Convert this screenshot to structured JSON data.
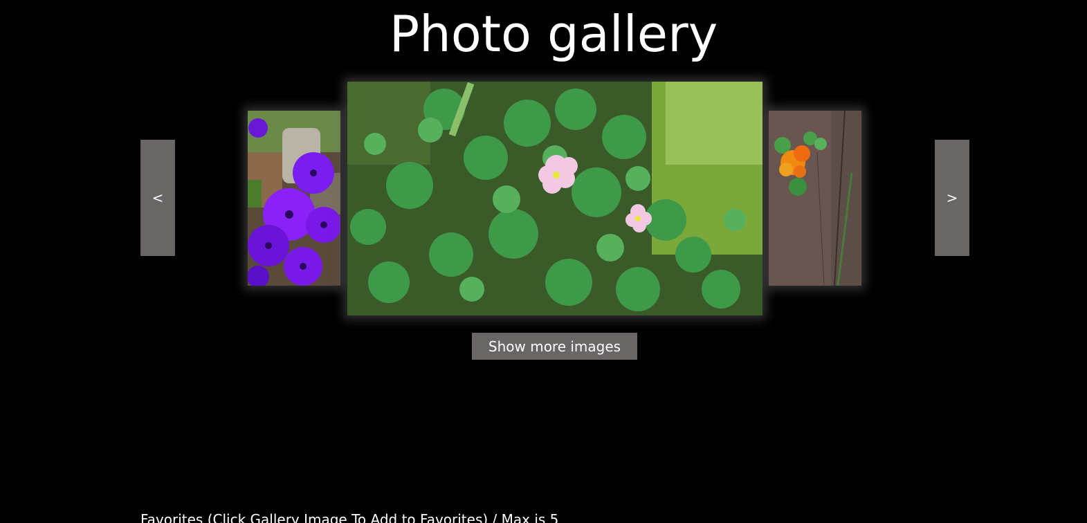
{
  "page": {
    "title": "Photo gallery"
  },
  "gallery": {
    "prev_label": "<",
    "next_label": ">",
    "images": [
      {
        "name": "purple-flowers-photo",
        "description": "purple cineraria flowers"
      },
      {
        "name": "clover-pink-flowers-photo",
        "description": "clover with pink flowers"
      },
      {
        "name": "orange-nasturtium-photo",
        "description": "orange nasturtium on fence"
      }
    ],
    "show_more_label": "Show more images"
  },
  "favorites": {
    "label": "Favorites (Click Gallery Image To Add to Favorites) / Max is 5"
  },
  "colors": {
    "background": "#000000",
    "button_bg": "#6b6666",
    "text": "#ffffff"
  }
}
